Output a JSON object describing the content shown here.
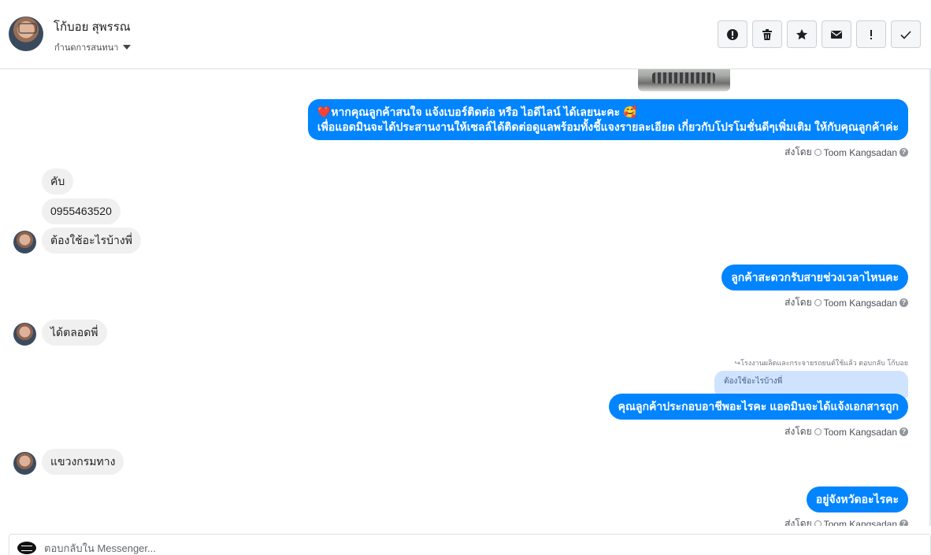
{
  "header": {
    "contact_name": "โก้บอย สุพรรณ",
    "conversation_status": "กำนดการสนทนา",
    "toolbar": [
      {
        "name": "spam-button",
        "icon": "alert-circle-icon"
      },
      {
        "name": "delete-button",
        "icon": "trash-icon"
      },
      {
        "name": "star-button",
        "icon": "star-icon"
      },
      {
        "name": "mark-unread-button",
        "icon": "envelope-icon"
      },
      {
        "name": "important-button",
        "icon": "exclamation-icon"
      },
      {
        "name": "done-button",
        "icon": "check-icon"
      }
    ]
  },
  "messages": {
    "m1_line1": "❤️หากคุณลูกค้าสนใจ แจ้งเบอร์ติดต่อ หรือ ไอดีไลน์ ได้เลยนะคะ 🥰",
    "m1_line2": "เพื่อแอดมินจะได้ประสานงานให้เซลล์ได้ติดต่อดูแลพร้อมทั้งชี้แจงรายละเอียด เกี่ยวกับโปรโมชั่นดีๆเพิ่มเติม ให้กับคุณลูกค้าค่ะ",
    "sent_by_label": "ส่งโดย",
    "sender": "Toom Kangsadan",
    "help": "?",
    "in1": "คับ",
    "in2": "0955463520",
    "in3": "ต้องใช้อะไรบ้างพี่",
    "m2": "ลูกค้าสะดวกรับสายช่วงเวลาไหนคะ",
    "in4": "ได้ตลอดพี่",
    "reply_note": "↪โรงงานผลิตและกระจายรถยนต์ใช้แล้ว ตอบกลับ โก้บอย",
    "quoted": "ต้องใช้อะไรบ้างพี่",
    "m3": "คุณลูกค้าประกอบอาชีพอะไรคะ แอดมินจะได้แจ้งเอกสารถูก",
    "in5": "แขวงกรมทาง",
    "m4": "อยู่จังหวัดอะไรคะ"
  },
  "composer": {
    "placeholder": "ตอบกลับใน Messenger..."
  }
}
